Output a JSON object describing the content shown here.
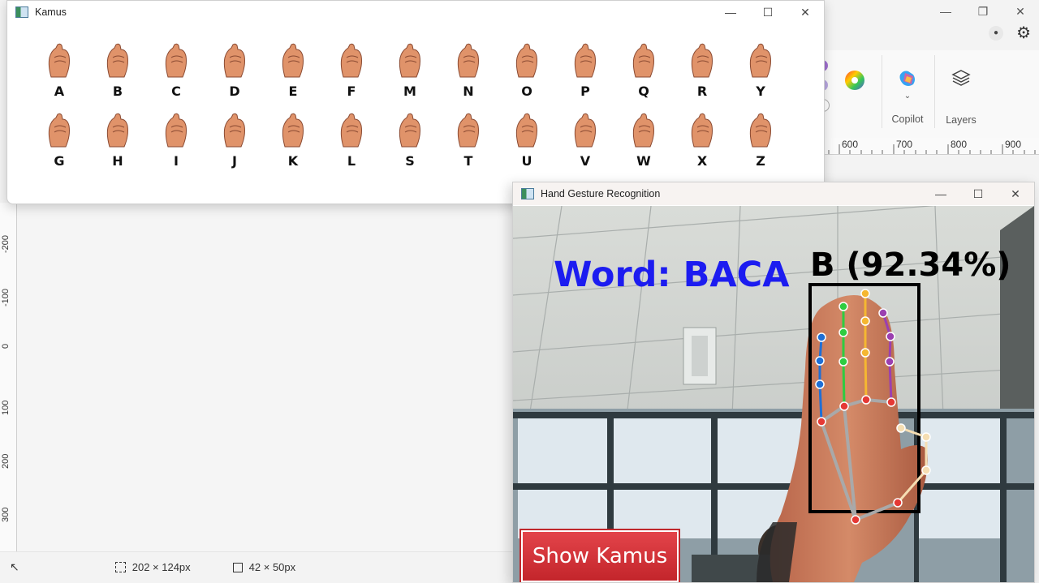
{
  "paint": {
    "ribbon": {
      "copilot_label": "Copilot",
      "layers_label": "Layers"
    },
    "ruler_h": [
      "600",
      "700",
      "800",
      "900"
    ],
    "ruler_v": [
      "200",
      "-200",
      "-100",
      "0",
      "100",
      "200",
      "300"
    ],
    "status": {
      "selection_size": "202 × 124px",
      "canvas_size": "42 × 50px"
    }
  },
  "kamus": {
    "title": "Kamus",
    "row1": [
      "A",
      "B",
      "C",
      "D",
      "E",
      "F",
      "M",
      "N",
      "O",
      "P",
      "Q",
      "R",
      "Y"
    ],
    "row2": [
      "G",
      "H",
      "I",
      "J",
      "K",
      "L",
      "S",
      "T",
      "U",
      "V",
      "W",
      "X",
      "Z"
    ]
  },
  "gesture": {
    "title": "Hand Gesture Recognition",
    "word": "Word:  BACA",
    "prediction": "B (92.34%)",
    "show_button": "Show Kamus"
  },
  "colors": {
    "word_text": "#1c1cf0",
    "button_red": "#d0353a",
    "skin": "#e0936a",
    "landmark_red": "#e53935",
    "thumb_blue": "#1e6fd6",
    "index_green": "#2ecc40",
    "middle_yellow": "#f5b731",
    "ring_purple": "#9b3fb0"
  }
}
